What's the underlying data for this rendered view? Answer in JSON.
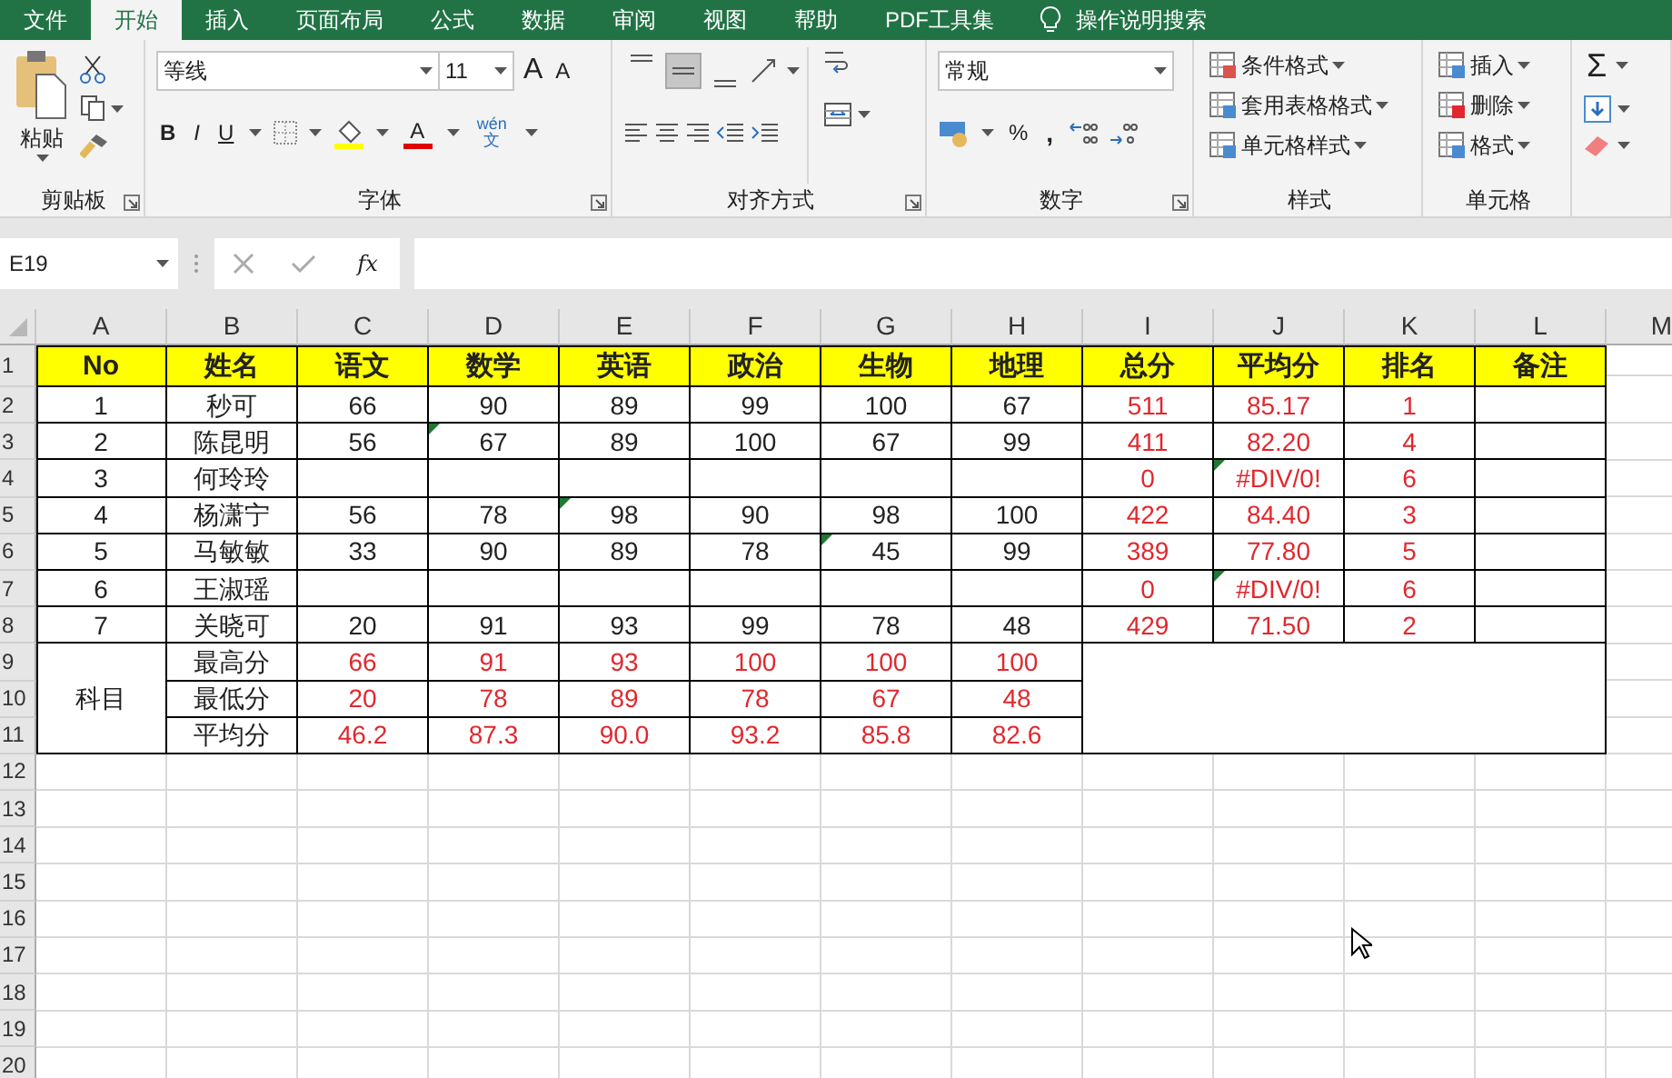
{
  "menu_tabs": [
    {
      "label": "文件",
      "selected": false
    },
    {
      "label": "开始",
      "selected": true
    },
    {
      "label": "插入",
      "selected": false
    },
    {
      "label": "页面布局",
      "selected": false
    },
    {
      "label": "公式",
      "selected": false
    },
    {
      "label": "数据",
      "selected": false
    },
    {
      "label": "审阅",
      "selected": false
    },
    {
      "label": "视图",
      "selected": false
    },
    {
      "label": "帮助",
      "selected": false
    },
    {
      "label": "PDF工具集",
      "selected": false
    }
  ],
  "tell_me": "操作说明搜索",
  "ribbon": {
    "groups": [
      {
        "kind": "clipboard",
        "label": "剪贴板",
        "launcher": true,
        "paste": "粘贴"
      },
      {
        "kind": "font",
        "label": "字体",
        "launcher": true,
        "font": "等线",
        "size": "11",
        "grow": "A",
        "shrink": "A",
        "bold": "B",
        "italic": "I",
        "underline": "U",
        "font_color": "A",
        "phonetic": "wén",
        "phonetic_char": "文"
      },
      {
        "kind": "alignment",
        "label": "对齐方式",
        "launcher": true,
        "vertical_align": [
          {
            "selected": false
          },
          {
            "selected": true
          },
          {
            "selected": false
          }
        ]
      },
      {
        "kind": "number",
        "label": "数字",
        "launcher": true,
        "format": "常规",
        "percent": "%",
        "comma": ","
      },
      {
        "kind": "styles",
        "label": "样式",
        "items": [
          "条件格式",
          "套用表格格式",
          "单元格样式"
        ]
      },
      {
        "kind": "cells",
        "label": "单元格",
        "items": [
          "插入",
          "删除",
          "格式"
        ]
      },
      {
        "kind": "editing",
        "sum": "Σ"
      }
    ]
  },
  "formula_bar": {
    "name_box": "E19",
    "function_button": "fx"
  },
  "sheet": {
    "columns": [
      "A",
      "B",
      "C",
      "D",
      "E",
      "F",
      "G",
      "H",
      "I",
      "J",
      "K",
      "L",
      "M"
    ],
    "row_numbers": [
      "1",
      "2",
      "3",
      "4",
      "5",
      "6",
      "7",
      "8",
      "9",
      "10",
      "11",
      "12",
      "13",
      "14",
      "15",
      "16",
      "17",
      "18",
      "19",
      "20"
    ],
    "summary_label": "科目",
    "rows": [
      {
        "kind": "header",
        "cells": [
          {
            "t": "No",
            "red": false,
            "flag": false
          },
          {
            "t": "姓名",
            "red": false,
            "flag": false
          },
          {
            "t": "语文",
            "red": false,
            "flag": false
          },
          {
            "t": "数学",
            "red": false,
            "flag": false
          },
          {
            "t": "英语",
            "red": false,
            "flag": false
          },
          {
            "t": "政治",
            "red": false,
            "flag": false
          },
          {
            "t": "生物",
            "red": false,
            "flag": false
          },
          {
            "t": "地理",
            "red": false,
            "flag": false
          },
          {
            "t": "总分",
            "red": false,
            "flag": false
          },
          {
            "t": "平均分",
            "red": false,
            "flag": false
          },
          {
            "t": "排名",
            "red": false,
            "flag": false
          },
          {
            "t": "备注",
            "red": false,
            "flag": false
          }
        ]
      },
      {
        "kind": "data",
        "cells": [
          {
            "t": "1",
            "red": false,
            "flag": false
          },
          {
            "t": "秒可",
            "red": false,
            "flag": false
          },
          {
            "t": "66",
            "red": false,
            "flag": false
          },
          {
            "t": "90",
            "red": false,
            "flag": false
          },
          {
            "t": "89",
            "red": false,
            "flag": false
          },
          {
            "t": "99",
            "red": false,
            "flag": false
          },
          {
            "t": "100",
            "red": false,
            "flag": false
          },
          {
            "t": "67",
            "red": false,
            "flag": false
          },
          {
            "t": "511",
            "red": true,
            "flag": false
          },
          {
            "t": "85.17",
            "red": true,
            "flag": false
          },
          {
            "t": "1",
            "red": true,
            "flag": false
          },
          {}
        ]
      },
      {
        "kind": "data",
        "cells": [
          {
            "t": "2",
            "red": false,
            "flag": false
          },
          {
            "t": "陈昆明",
            "red": false,
            "flag": false
          },
          {
            "t": "56",
            "red": false,
            "flag": false
          },
          {
            "t": "67",
            "red": false,
            "flag": true
          },
          {
            "t": "89",
            "red": false,
            "flag": false
          },
          {
            "t": "100",
            "red": false,
            "flag": false
          },
          {
            "t": "67",
            "red": false,
            "flag": false
          },
          {
            "t": "99",
            "red": false,
            "flag": false
          },
          {
            "t": "411",
            "red": true,
            "flag": false
          },
          {
            "t": "82.20",
            "red": true,
            "flag": false
          },
          {
            "t": "4",
            "red": true,
            "flag": false
          },
          {}
        ]
      },
      {
        "kind": "data",
        "cells": [
          {
            "t": "3",
            "red": false,
            "flag": false
          },
          {
            "t": "何玲玲",
            "red": false,
            "flag": false
          },
          {},
          {},
          {},
          {},
          {},
          {},
          {
            "t": "0",
            "red": true,
            "flag": false
          },
          {
            "t": "#DIV/0!",
            "red": true,
            "flag": true
          },
          {
            "t": "6",
            "red": true,
            "flag": false
          },
          {}
        ]
      },
      {
        "kind": "data",
        "cells": [
          {
            "t": "4",
            "red": false,
            "flag": false
          },
          {
            "t": "杨潇宁",
            "red": false,
            "flag": false
          },
          {
            "t": "56",
            "red": false,
            "flag": false
          },
          {
            "t": "78",
            "red": false,
            "flag": false
          },
          {
            "t": "98",
            "red": false,
            "flag": true
          },
          {
            "t": "90",
            "red": false,
            "flag": false
          },
          {
            "t": "98",
            "red": false,
            "flag": false
          },
          {
            "t": "100",
            "red": false,
            "flag": false
          },
          {
            "t": "422",
            "red": true,
            "flag": false
          },
          {
            "t": "84.40",
            "red": true,
            "flag": false
          },
          {
            "t": "3",
            "red": true,
            "flag": false
          },
          {}
        ]
      },
      {
        "kind": "data",
        "cells": [
          {
            "t": "5",
            "red": false,
            "flag": false
          },
          {
            "t": "马敏敏",
            "red": false,
            "flag": false
          },
          {
            "t": "33",
            "red": false,
            "flag": false
          },
          {
            "t": "90",
            "red": false,
            "flag": false
          },
          {
            "t": "89",
            "red": false,
            "flag": false
          },
          {
            "t": "78",
            "red": false,
            "flag": false
          },
          {
            "t": "45",
            "red": false,
            "flag": true
          },
          {
            "t": "99",
            "red": false,
            "flag": false
          },
          {
            "t": "389",
            "red": true,
            "flag": false
          },
          {
            "t": "77.80",
            "red": true,
            "flag": false
          },
          {
            "t": "5",
            "red": true,
            "flag": false
          },
          {}
        ]
      },
      {
        "kind": "data",
        "cells": [
          {
            "t": "6",
            "red": false,
            "flag": false
          },
          {
            "t": "王淑瑶",
            "red": false,
            "flag": false
          },
          {},
          {},
          {},
          {},
          {},
          {},
          {
            "t": "0",
            "red": true,
            "flag": false
          },
          {
            "t": "#DIV/0!",
            "red": true,
            "flag": true
          },
          {
            "t": "6",
            "red": true,
            "flag": false
          },
          {}
        ]
      },
      {
        "kind": "data",
        "cells": [
          {
            "t": "7",
            "red": false,
            "flag": false
          },
          {
            "t": "关晓可",
            "red": false,
            "flag": false
          },
          {
            "t": "20",
            "red": false,
            "flag": false
          },
          {
            "t": "91",
            "red": false,
            "flag": false
          },
          {
            "t": "93",
            "red": false,
            "flag": false
          },
          {
            "t": "99",
            "red": false,
            "flag": false
          },
          {
            "t": "78",
            "red": false,
            "flag": false
          },
          {
            "t": "48",
            "red": false,
            "flag": false
          },
          {
            "t": "429",
            "red": true,
            "flag": false
          },
          {
            "t": "71.50",
            "red": true,
            "flag": false
          },
          {
            "t": "2",
            "red": true,
            "flag": false
          },
          {}
        ]
      },
      {
        "kind": "summary",
        "cells": [
          {
            "t": "最高分",
            "red": false,
            "flag": false
          },
          {
            "t": "66",
            "red": true,
            "flag": false
          },
          {
            "t": "91",
            "red": true,
            "flag": false
          },
          {
            "t": "93",
            "red": true,
            "flag": false
          },
          {
            "t": "100",
            "red": true,
            "flag": false
          },
          {
            "t": "100",
            "red": true,
            "flag": false
          },
          {
            "t": "100",
            "red": true,
            "flag": false
          }
        ]
      },
      {
        "kind": "summary",
        "cells": [
          {
            "t": "最低分",
            "red": false,
            "flag": false
          },
          {
            "t": "20",
            "red": true,
            "flag": false
          },
          {
            "t": "78",
            "red": true,
            "flag": false
          },
          {
            "t": "89",
            "red": true,
            "flag": false
          },
          {
            "t": "78",
            "red": true,
            "flag": false
          },
          {
            "t": "67",
            "red": true,
            "flag": false
          },
          {
            "t": "48",
            "red": true,
            "flag": false
          }
        ]
      },
      {
        "kind": "summary",
        "cells": [
          {
            "t": "平均分",
            "red": false,
            "flag": false
          },
          {
            "t": "46.2",
            "red": true,
            "flag": false
          },
          {
            "t": "87.3",
            "red": true,
            "flag": false
          },
          {
            "t": "90.0",
            "red": true,
            "flag": false
          },
          {
            "t": "93.2",
            "red": true,
            "flag": false
          },
          {
            "t": "85.8",
            "red": true,
            "flag": false
          },
          {
            "t": "82.6",
            "red": true,
            "flag": false
          }
        ]
      }
    ]
  }
}
